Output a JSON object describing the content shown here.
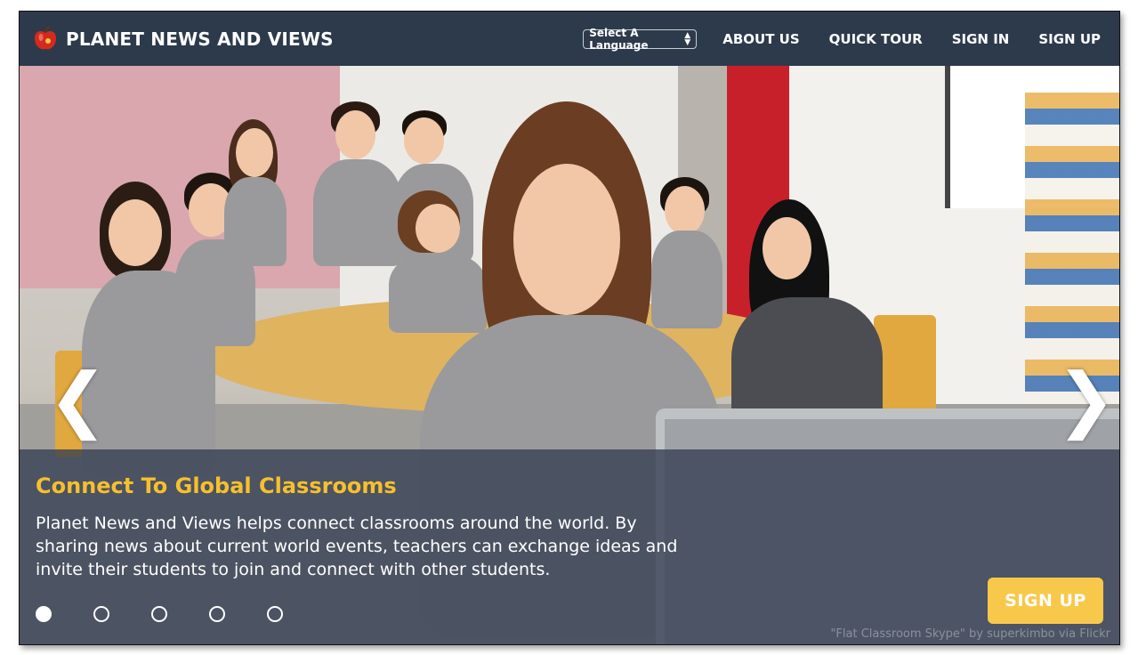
{
  "header": {
    "brand": "PLANET NEWS AND VIEWS",
    "language_select": "Select A Language",
    "nav": [
      "ABOUT US",
      "QUICK TOUR",
      "SIGN IN",
      "SIGN UP"
    ]
  },
  "hero": {
    "title": "Connect To Global Classrooms",
    "text": "Planet News and Views helps connect classrooms around the world. By sharing news about current world events, teachers can exchange ideas and invite their students to join and connect with other students.",
    "cta": "SIGN UP",
    "credit": "\"Flat Classroom Skype\" by superkimbo via Flickr",
    "prev_arrow": "❮",
    "next_arrow": "❯",
    "active_slide": 1,
    "slide_count": 5
  },
  "colors": {
    "nav_bg": "#2d3a4b",
    "accent": "#f6c02d",
    "cta_bg": "#f8c84a"
  },
  "icons": {
    "logo": "apple-icon",
    "select": "updown-icon",
    "prev": "chevron-left-icon",
    "next": "chevron-right-icon"
  }
}
